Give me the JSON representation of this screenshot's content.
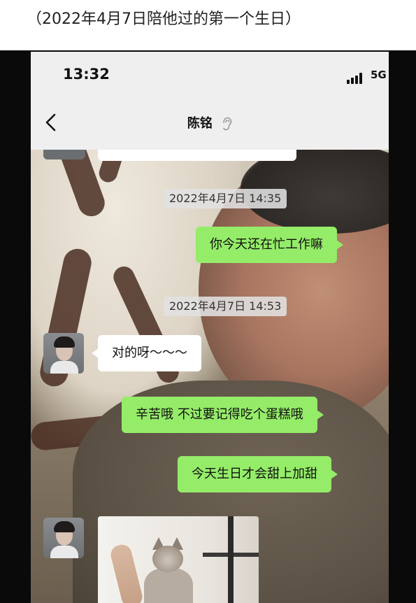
{
  "caption": "（2022年4月7日陪他过的第一个生日）",
  "status_bar": {
    "time": "13:32",
    "network": "5G"
  },
  "chat": {
    "contact_name": "陈铭",
    "messages": [
      {
        "type": "timestamp",
        "text": "2022年4月7日 14:35"
      },
      {
        "type": "outgoing",
        "text": "你今天还在忙工作嘛"
      },
      {
        "type": "timestamp",
        "text": "2022年4月7日 14:53"
      },
      {
        "type": "incoming",
        "text": "对的呀～～～"
      },
      {
        "type": "outgoing",
        "text": "辛苦哦 不过要记得吃个蛋糕哦"
      },
      {
        "type": "outgoing",
        "text": "今天生日才会甜上加甜"
      },
      {
        "type": "incoming-image",
        "text": ""
      }
    ]
  },
  "icons": {
    "back": "chevron-left-icon",
    "ear": "ear-icon",
    "signal": "signal-bars-icon"
  },
  "colors": {
    "outgoing_bubble": "#95ec69",
    "incoming_bubble": "#ffffff",
    "nav_bg": "#efefef"
  }
}
